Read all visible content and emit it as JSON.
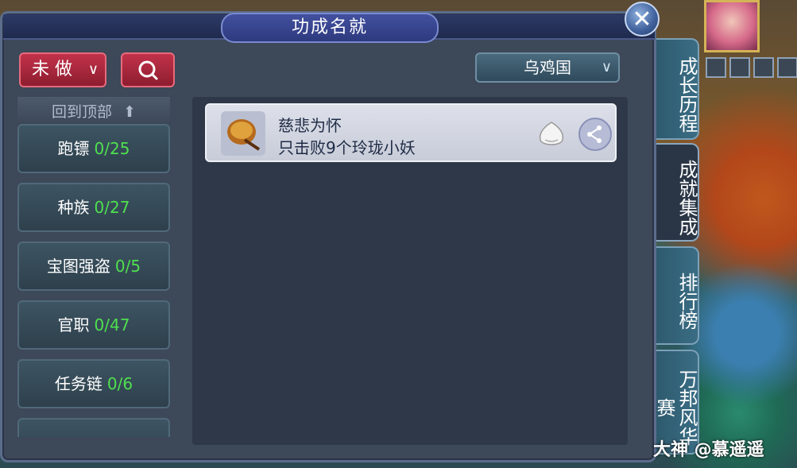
{
  "title": "功成名就",
  "close_icon": "close-icon",
  "filter_button": {
    "label": "未 做",
    "icon": "chevron-down-icon"
  },
  "search_button": {
    "icon": "search-icon"
  },
  "region_select": {
    "value": "乌鸡国",
    "icon": "chevron-down-icon"
  },
  "left_list": {
    "back_to_top": "回到顶部",
    "back_icon": "arrow-up-icon",
    "categories": [
      {
        "name": "跑镖",
        "count": "0/25"
      },
      {
        "name": "种族",
        "count": "0/27"
      },
      {
        "name": "宝图强盗",
        "count": "0/5"
      },
      {
        "name": "官职",
        "count": "0/47"
      },
      {
        "name": "任务链",
        "count": "0/6"
      }
    ]
  },
  "achievement": {
    "name": "慈悲为怀",
    "description": "只击败9个玲珑小妖",
    "icon": "drum-icon",
    "reward_icon": "fruit-icon",
    "share_icon": "share-icon"
  },
  "side_tabs": [
    "成长历程",
    "成就集成",
    "排行榜",
    "万邦风华赛"
  ],
  "active_tab": "成就集成",
  "watermark": "大神 @慕遥遥",
  "colors": {
    "panel": "#3d4859",
    "title_bar": "#2e3a7e",
    "red_button": "#c2324a",
    "count_green": "#4fe04f",
    "card": "#dde0ea"
  }
}
